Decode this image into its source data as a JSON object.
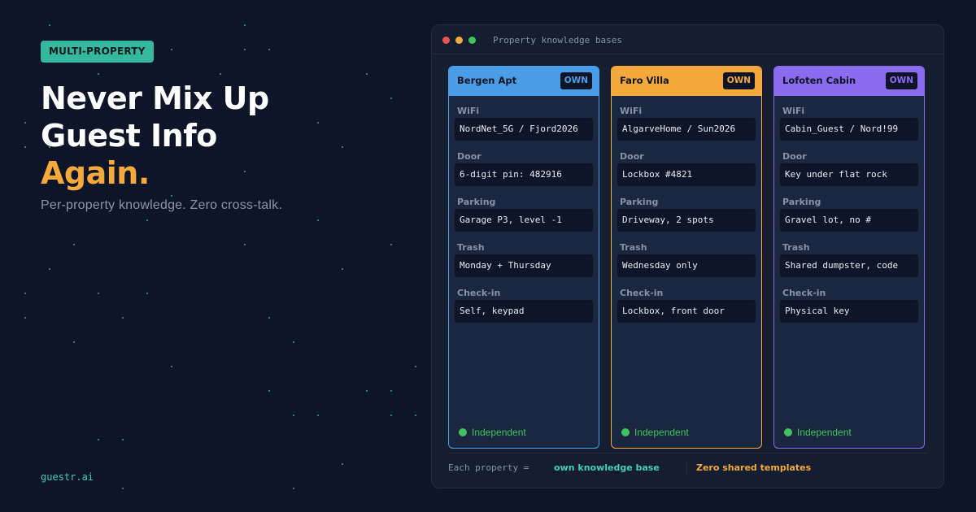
{
  "badge": "MULTI-PROPERTY",
  "headline": {
    "line1": "Never Mix Up",
    "line2": "Guest Info",
    "accent": "Again."
  },
  "subheadline": "Per-property knowledge. Zero cross-talk.",
  "site": "guestr.ai",
  "colors": {
    "background": "#0f1528",
    "teal": "#3fd0b5",
    "orange": "#f5a93a",
    "blue": "#4a9ee8",
    "purple": "#8b6cf0",
    "green": "#3ec45a"
  },
  "window": {
    "title": "Property knowledge bases",
    "properties": [
      {
        "name": "Bergen Apt",
        "tag": "OWN",
        "color": "#4a9ee8",
        "fields": [
          {
            "label": "WiFi",
            "value": "NordNet_5G / Fjord2026"
          },
          {
            "label": "Door",
            "value": "6-digit pin: 482916"
          },
          {
            "label": "Parking",
            "value": "Garage P3, level -1"
          },
          {
            "label": "Trash",
            "value": "Monday + Thursday"
          },
          {
            "label": "Check-in",
            "value": "Self, keypad"
          }
        ],
        "status": "Independent"
      },
      {
        "name": "Faro Villa",
        "tag": "OWN",
        "color": "#f5a93a",
        "fields": [
          {
            "label": "WiFi",
            "value": "AlgarveHome / Sun2026"
          },
          {
            "label": "Door",
            "value": "Lockbox #4821"
          },
          {
            "label": "Parking",
            "value": "Driveway, 2 spots"
          },
          {
            "label": "Trash",
            "value": "Wednesday only"
          },
          {
            "label": "Check-in",
            "value": "Lockbox, front door"
          }
        ],
        "status": "Independent"
      },
      {
        "name": "Lofoten Cabin",
        "tag": "OWN",
        "color": "#8b6cf0",
        "fields": [
          {
            "label": "WiFi",
            "value": "Cabin_Guest / Nord!99"
          },
          {
            "label": "Door",
            "value": "Key under flat rock"
          },
          {
            "label": "Parking",
            "value": "Gravel lot, no #"
          },
          {
            "label": "Trash",
            "value": "Shared dumpster, code"
          },
          {
            "label": "Check-in",
            "value": "Physical key"
          }
        ],
        "status": "Independent"
      }
    ],
    "footer": {
      "label": "Each property =",
      "own": "own knowledge base",
      "zero": "Zero shared templates"
    }
  }
}
